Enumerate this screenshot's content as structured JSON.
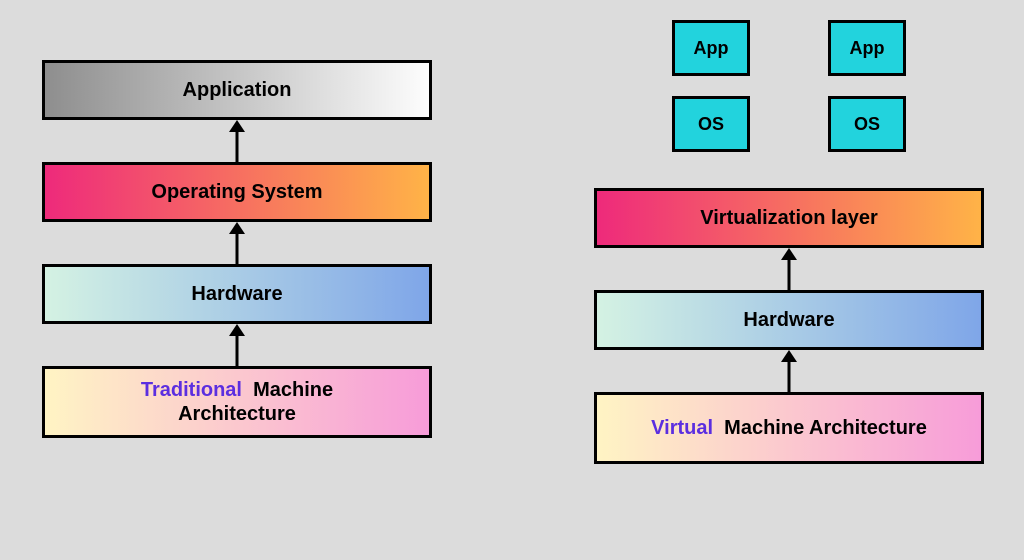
{
  "left": {
    "application": "Application",
    "os": "Operating System",
    "hardware": "Hardware",
    "title_accent": "Traditional",
    "title_rest": "Machine",
    "title_line2": "Architecture"
  },
  "right": {
    "app1": "App",
    "app2": "App",
    "os1": "OS",
    "os2": "OS",
    "virt": "Virtualization layer",
    "hardware": "Hardware",
    "title_accent": "Virtual",
    "title_rest": "Machine Architecture"
  }
}
